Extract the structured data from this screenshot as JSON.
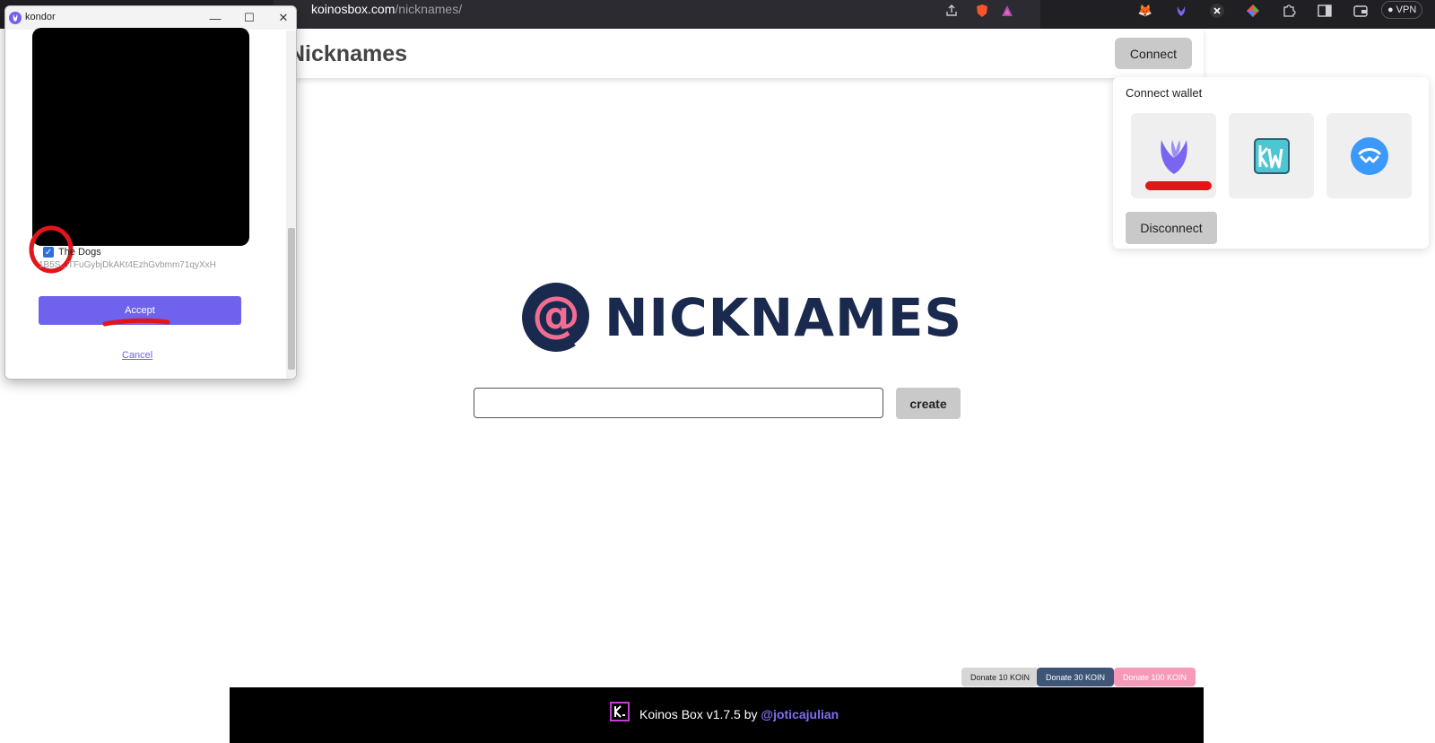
{
  "browser": {
    "url_host": "koinosbox.com",
    "url_path": "/nicknames/",
    "vpn_label": "VPN"
  },
  "page": {
    "title": "Nicknames",
    "connect_label": "Connect",
    "wallet_panel": {
      "title": "Connect wallet",
      "disconnect_label": "Disconnect"
    },
    "logo_text": "NICKNAMES",
    "create_label": "create",
    "donate": [
      "Donate 10 KOIN",
      "Donate 30 KOIN",
      "Donate 100 KOIN"
    ],
    "footer": {
      "text": "Koinos Box v1.7.5 by ",
      "link": "@joticajulian"
    }
  },
  "popup": {
    "title": "kondor",
    "nft_name": "The Dogs",
    "nft_address": "1B5S...TFuGybjDkAKt4EzhGvbmm71qyXxH",
    "accept_label": "Accept",
    "cancel_label": "Cancel"
  },
  "colors": {
    "accent": "#6f63ee",
    "logo_navy": "#1a2a4f",
    "logo_pink": "#f26d91",
    "annotation_red": "#e0161b"
  }
}
